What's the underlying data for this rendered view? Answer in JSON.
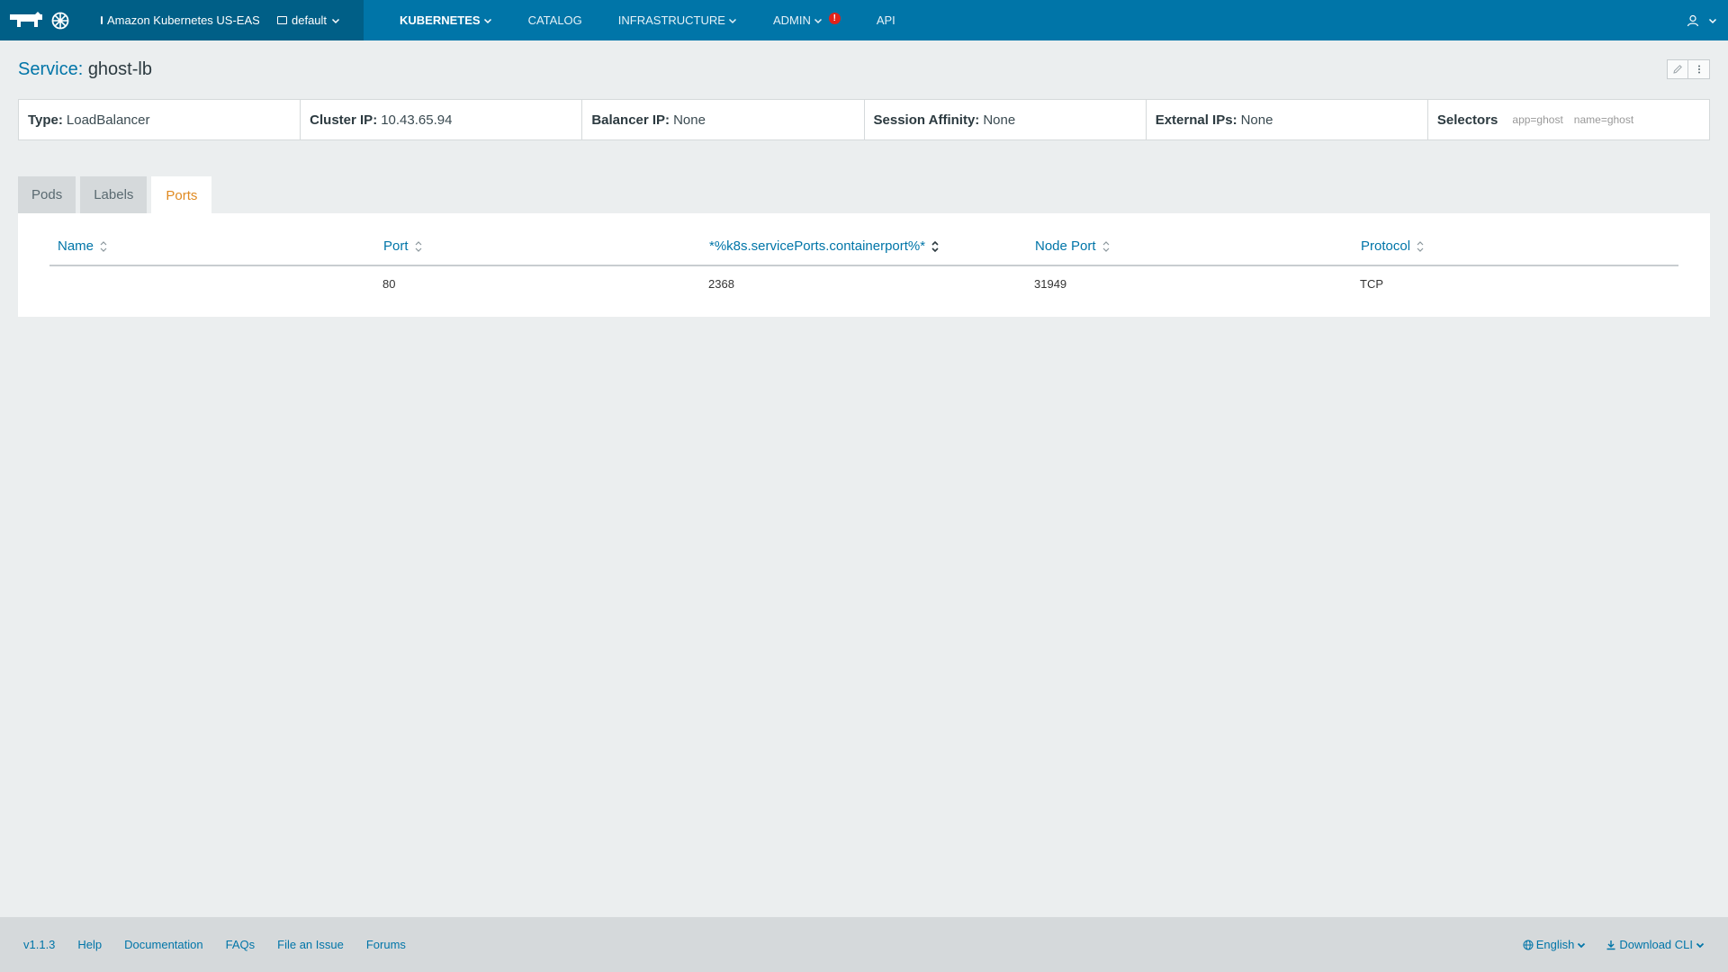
{
  "nav": {
    "cluster": "Amazon Kubernetes US-EAS",
    "namespace": "default",
    "items": [
      {
        "label": "KUBERNETES",
        "active": true,
        "dropdown": true
      },
      {
        "label": "CATALOG",
        "active": false,
        "dropdown": false
      },
      {
        "label": "INFRASTRUCTURE",
        "active": false,
        "dropdown": true
      },
      {
        "label": "ADMIN",
        "active": false,
        "dropdown": true,
        "alert": "!"
      },
      {
        "label": "API",
        "active": false,
        "dropdown": false
      }
    ]
  },
  "page": {
    "title_prefix": "Service:",
    "title_name": "ghost-lb"
  },
  "info": {
    "type_label": "Type:",
    "type_value": "LoadBalancer",
    "cluster_ip_label": "Cluster IP:",
    "cluster_ip_value": "10.43.65.94",
    "balancer_ip_label": "Balancer IP:",
    "balancer_ip_value": "None",
    "session_affinity_label": "Session Affinity:",
    "session_affinity_value": "None",
    "external_ips_label": "External IPs:",
    "external_ips_value": "None",
    "selectors_label": "Selectors",
    "selectors": [
      "app=ghost",
      "name=ghost"
    ]
  },
  "tabs": [
    {
      "label": "Pods",
      "active": false
    },
    {
      "label": "Labels",
      "active": false
    },
    {
      "label": "Ports",
      "active": true
    }
  ],
  "ports_table": {
    "columns": [
      "Name",
      "Port",
      "*%k8s.servicePorts.containerport%*",
      "Node Port",
      "Protocol"
    ],
    "rows": [
      {
        "name": "",
        "port": "80",
        "container_port": "2368",
        "node_port": "31949",
        "protocol": "TCP"
      }
    ]
  },
  "footer": {
    "version": "v1.1.3",
    "links": [
      "Help",
      "Documentation",
      "FAQs",
      "File an Issue",
      "Forums"
    ],
    "language": "English",
    "download": "Download CLI"
  },
  "colors": {
    "nav_bg": "#0075a8",
    "nav_dark": "#005f87",
    "accent_tab": "#e08a21",
    "link": "#0075a8",
    "alert": "#e2231a"
  }
}
